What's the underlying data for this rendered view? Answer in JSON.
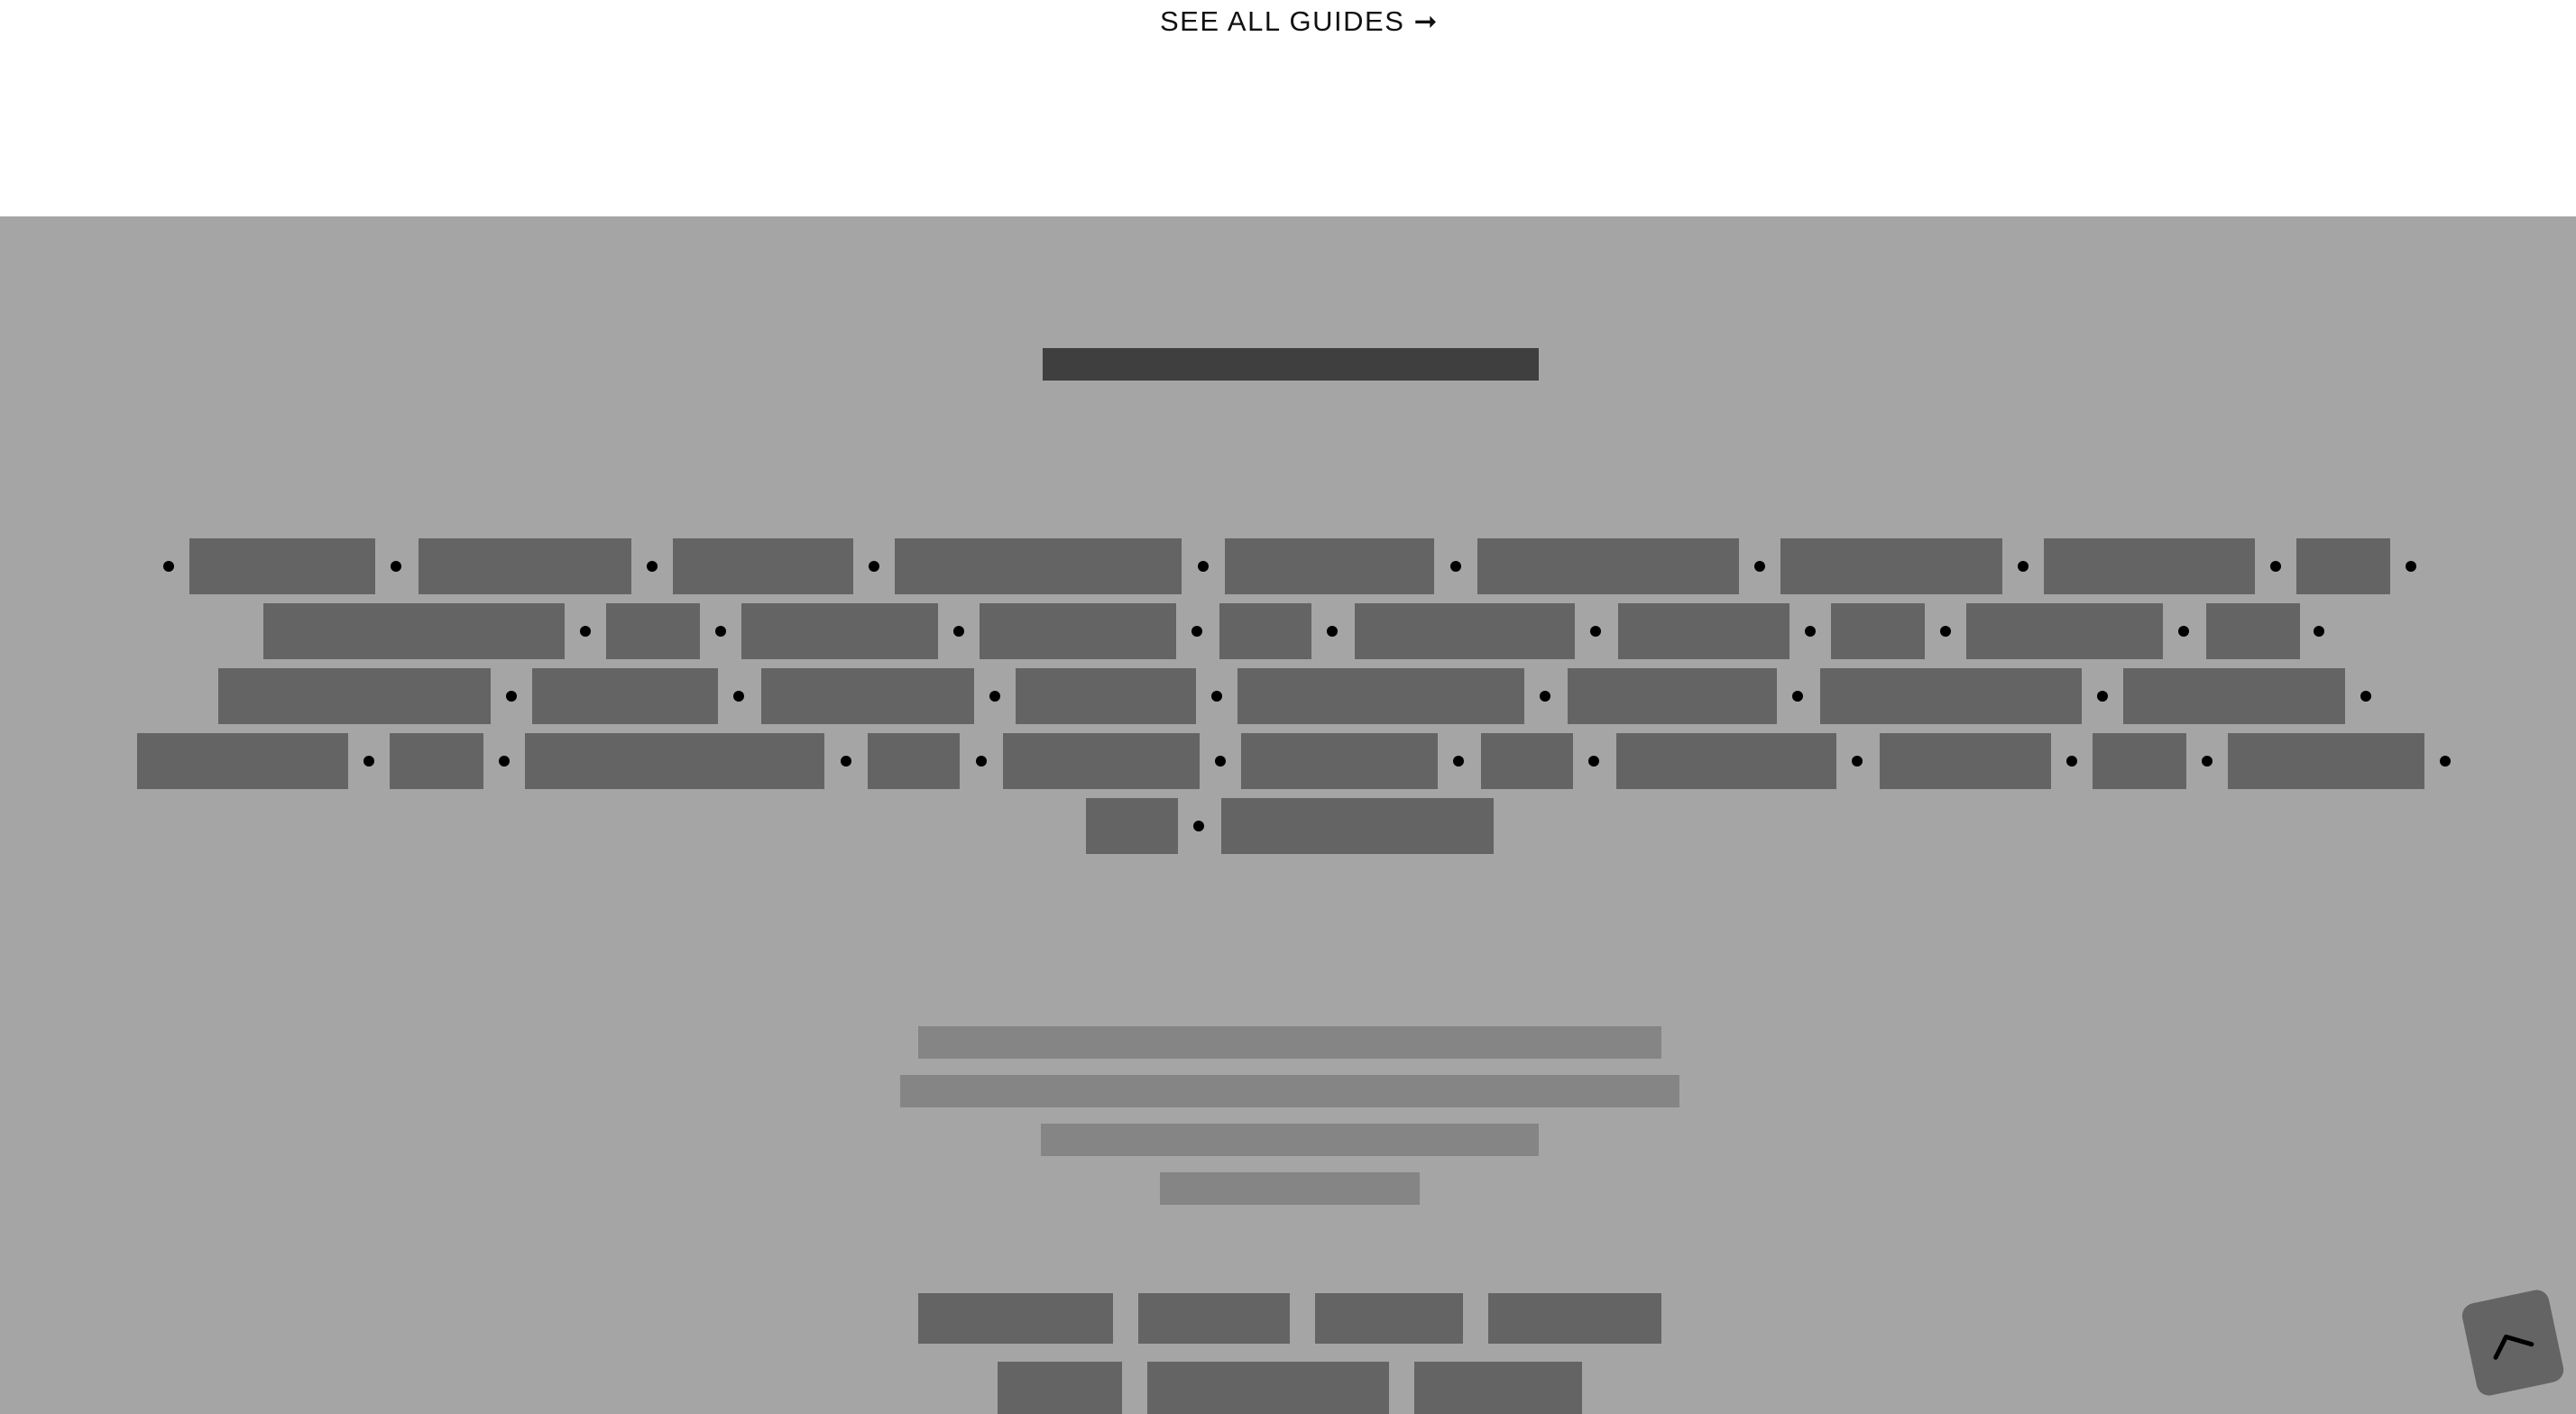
{
  "top": {
    "see_all_label": "SEE ALL GUIDES",
    "arrow_icon": "arrow-right-icon"
  },
  "footer": {
    "background": "#a5a5a5",
    "heading_color": "#3f3f3f",
    "tag_color": "#646464",
    "text_color": "#858585",
    "scroll_top_icon": "chevron-up-icon"
  }
}
